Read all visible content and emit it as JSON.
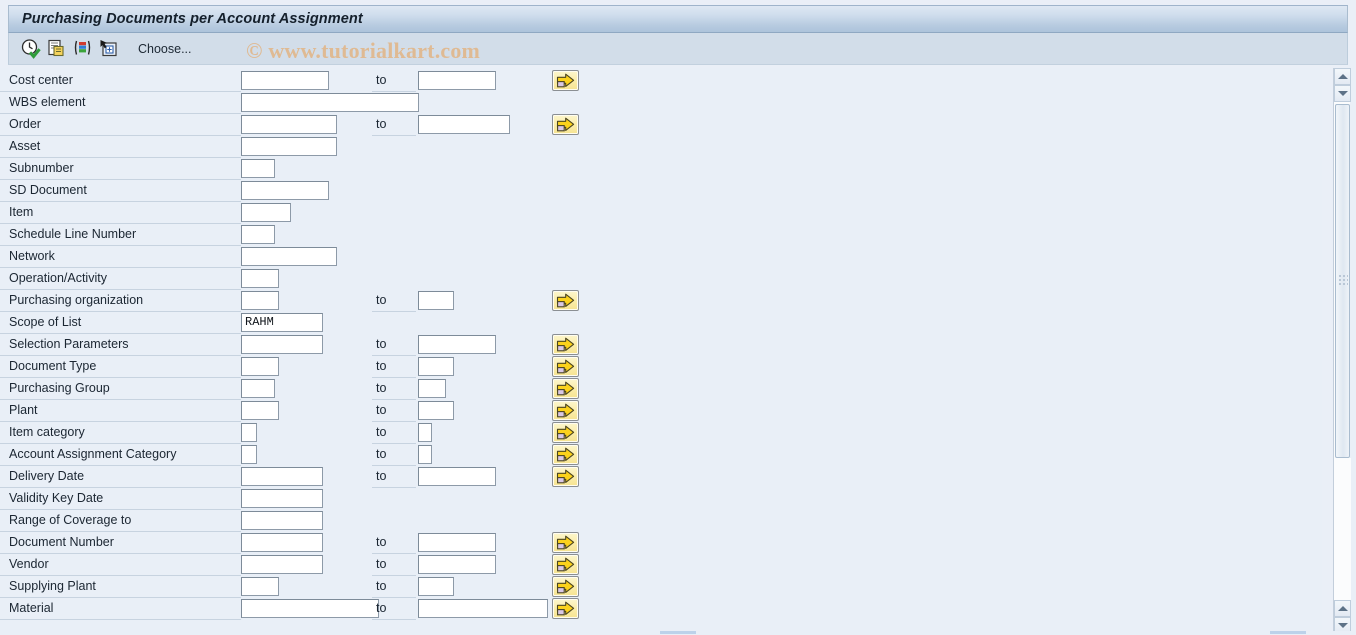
{
  "window": {
    "title": "Purchasing Documents per Account Assignment"
  },
  "toolbar": {
    "icons": [
      {
        "name": "execute-clock-icon"
      },
      {
        "name": "copy-variant-icon"
      },
      {
        "name": "color-bars-icon"
      },
      {
        "name": "select-layout-icon"
      }
    ],
    "choose_label": "Choose..."
  },
  "watermark": {
    "text": "© www.tutorialkart.com",
    "color": "#e2b485"
  },
  "form": {
    "to_label": "to",
    "rows": [
      {
        "label": "Cost center",
        "low_w": 88,
        "low_val": "",
        "has_to": true,
        "high_w": 78,
        "has_msel": true
      },
      {
        "label": "WBS element",
        "low_w": 178,
        "low_val": "",
        "has_to": false,
        "high_w": 0,
        "has_msel": false
      },
      {
        "label": "Order",
        "low_w": 96,
        "low_val": "",
        "has_to": true,
        "high_w": 92,
        "has_msel": true
      },
      {
        "label": "Asset",
        "low_w": 96,
        "low_val": "",
        "has_to": false,
        "high_w": 0,
        "has_msel": false
      },
      {
        "label": "Subnumber",
        "low_w": 34,
        "low_val": "",
        "has_to": false,
        "high_w": 0,
        "has_msel": false
      },
      {
        "label": "SD Document",
        "low_w": 88,
        "low_val": "",
        "has_to": false,
        "high_w": 0,
        "has_msel": false
      },
      {
        "label": "Item",
        "low_w": 50,
        "low_val": "",
        "has_to": false,
        "high_w": 0,
        "has_msel": false
      },
      {
        "label": "Schedule Line Number",
        "low_w": 34,
        "low_val": "",
        "has_to": false,
        "high_w": 0,
        "has_msel": false
      },
      {
        "label": "Network",
        "low_w": 96,
        "low_val": "",
        "has_to": false,
        "high_w": 0,
        "has_msel": false
      },
      {
        "label": "Operation/Activity",
        "low_w": 38,
        "low_val": "",
        "has_to": false,
        "high_w": 0,
        "has_msel": false
      },
      {
        "label": "Purchasing organization",
        "low_w": 38,
        "low_val": "",
        "has_to": true,
        "high_w": 36,
        "has_msel": true
      },
      {
        "label": "Scope of List",
        "low_w": 82,
        "low_val": "RAHM",
        "has_to": false,
        "high_w": 0,
        "has_msel": false
      },
      {
        "label": "Selection Parameters",
        "low_w": 82,
        "low_val": "",
        "has_to": true,
        "high_w": 78,
        "has_msel": true
      },
      {
        "label": "Document Type",
        "low_w": 38,
        "low_val": "",
        "has_to": true,
        "high_w": 36,
        "has_msel": true
      },
      {
        "label": "Purchasing Group",
        "low_w": 34,
        "low_val": "",
        "has_to": true,
        "high_w": 28,
        "has_msel": true
      },
      {
        "label": "Plant",
        "low_w": 38,
        "low_val": "",
        "has_to": true,
        "high_w": 36,
        "has_msel": true
      },
      {
        "label": "Item category",
        "low_w": 16,
        "low_val": "",
        "has_to": true,
        "high_w": 14,
        "has_msel": true
      },
      {
        "label": "Account Assignment Category",
        "low_w": 16,
        "low_val": "",
        "has_to": true,
        "high_w": 14,
        "has_msel": true
      },
      {
        "label": "Delivery Date",
        "low_w": 82,
        "low_val": "",
        "has_to": true,
        "high_w": 78,
        "has_msel": true
      },
      {
        "label": "Validity Key Date",
        "low_w": 82,
        "low_val": "",
        "has_to": false,
        "high_w": 0,
        "has_msel": false
      },
      {
        "label": "Range of Coverage to",
        "low_w": 82,
        "low_val": "",
        "has_to": false,
        "high_w": 0,
        "has_msel": false
      },
      {
        "label": "Document Number",
        "low_w": 82,
        "low_val": "",
        "has_to": true,
        "high_w": 78,
        "has_msel": true
      },
      {
        "label": "Vendor",
        "low_w": 82,
        "low_val": "",
        "has_to": true,
        "high_w": 78,
        "has_msel": true
      },
      {
        "label": "Supplying Plant",
        "low_w": 38,
        "low_val": "",
        "has_to": true,
        "high_w": 36,
        "has_msel": true
      },
      {
        "label": "Material",
        "low_w": 138,
        "low_val": "",
        "has_to": true,
        "high_w": 130,
        "has_msel": true
      }
    ]
  },
  "scrollbar": {
    "up_icon": "scroll-up-icon",
    "down_icon": "scroll-down-icon",
    "thumb_grip_icon": "scrollbar-grip-icon"
  }
}
